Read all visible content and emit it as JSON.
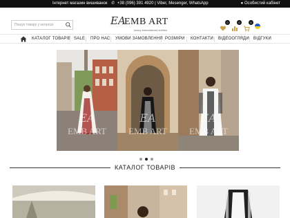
{
  "topbar": {
    "store_label": "Інтернет магазин вишиванок",
    "phone": "+38 (096) 391 4920 | Viber, Mesenger, WhatsApp",
    "account": "Особистий кабінет"
  },
  "search": {
    "placeholder": "Пошук товару у каталозі"
  },
  "logo": {
    "monogram": "EA",
    "brand": "EMB ART",
    "tagline": "luxury embroidered clothes"
  },
  "header_icons": {
    "wishlist_count": "0",
    "compare_count": "0",
    "cart_count": "0",
    "language": "ukraine-flag"
  },
  "nav": {
    "items": [
      "КАТАЛОГ ТОВАРІВ",
      "SALE",
      "ПРО НАС",
      "УМОВИ ЗАМОВЛЕННЯ",
      "РОЗМІРИ",
      "КОНТАКТИ",
      "ВІДЕООГЛЯДИ",
      "ВІДГУКИ"
    ]
  },
  "hero": {
    "slides_total": 3,
    "active_slide": 2,
    "watermark_monogram": "EA",
    "watermark_brand": "EMB ART"
  },
  "catalog": {
    "title": "КАТАЛОГ ТОВАРІВ"
  },
  "colors": {
    "topbar": "#111111",
    "accent": "#222222"
  }
}
